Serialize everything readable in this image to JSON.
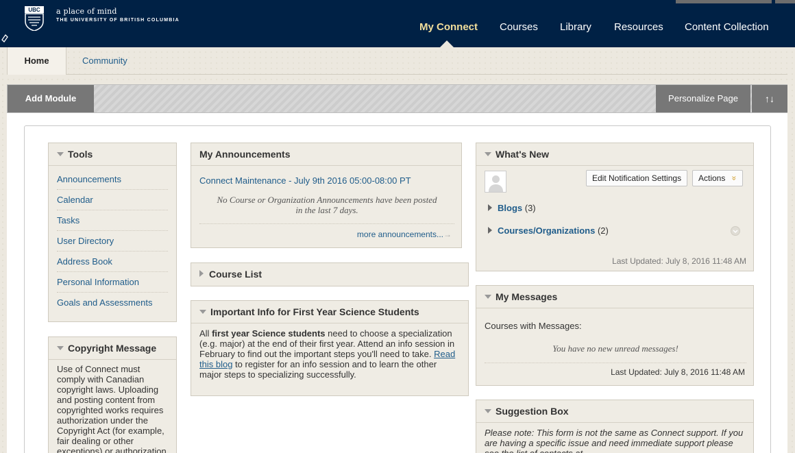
{
  "header": {
    "logo_text": "UBC",
    "tagline_line1": "a place of mind",
    "tagline_line2": "THE UNIVERSITY OF BRITISH COLUMBIA",
    "nav": [
      {
        "label": "My Connect"
      },
      {
        "label": "Courses"
      },
      {
        "label": "Library"
      },
      {
        "label": "Resources"
      },
      {
        "label": "Content Collection"
      }
    ]
  },
  "subtabs": {
    "home": "Home",
    "community": "Community"
  },
  "toolbar": {
    "add_module": "Add Module",
    "personalize": "Personalize Page",
    "reorder_icon": "↑↓"
  },
  "tools": {
    "title": "Tools",
    "items": [
      "Announcements",
      "Calendar",
      "Tasks",
      "User Directory",
      "Address Book",
      "Personal Information",
      "Goals and Assessments"
    ]
  },
  "copyright": {
    "title": "Copyright Message",
    "body": "Use of Connect must comply with Canadian copyright laws. Uploading and posting content from copyrighted works requires authorization under the Copyright Act (for example, fair dealing or other exceptions) or authorization"
  },
  "announcements": {
    "title": "My Announcements",
    "link": "Connect Maintenance - July 9th 2016 05:00-08:00 PT",
    "empty_line1": "No Course or Organization Announcements have been posted",
    "empty_line2": "in the last 7 days.",
    "more": "more announcements...",
    "more_arrow": "→"
  },
  "course_list": {
    "title": "Course List"
  },
  "important": {
    "title": "Important Info for First Year Science Students",
    "t1": "All ",
    "t2": "first year Science students",
    "t3": " need to choose a specialization (e.g. major) at the end of their first year.  Attend an info session in February to find out the important steps you'll need to take. ",
    "link": "Read this blog",
    "t4": " to register for an info session and to learn the other major steps to specializing successfully."
  },
  "whats_new": {
    "title": "What's New",
    "edit_btn": "Edit Notification Settings",
    "actions_btn": "Actions",
    "actions_icon": "»",
    "rows": [
      {
        "name": "Blogs",
        "count": "(3)"
      },
      {
        "name": "Courses/Organizations",
        "count": "(2)"
      }
    ],
    "updated": "Last Updated: July 8, 2016 11:48 AM"
  },
  "messages": {
    "title": "My Messages",
    "label": "Courses with Messages:",
    "empty": "You have no new unread messages!",
    "updated": "Last Updated: July 8, 2016 11:48 AM"
  },
  "suggestion": {
    "title": "Suggestion Box",
    "note": "Please note: This form is not the same as Connect support. If you are having a specific issue and need immediate support please see the list of contacts at"
  }
}
